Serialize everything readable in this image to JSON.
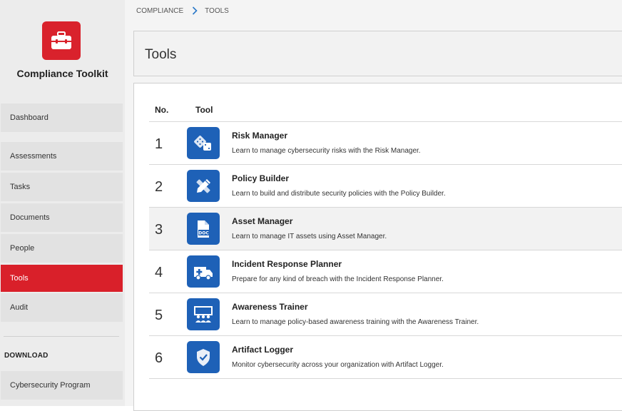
{
  "app": {
    "title": "Compliance Toolkit",
    "logo_icon": "toolbox-icon",
    "brand_color": "#d9222c"
  },
  "sidebar": {
    "items": [
      {
        "label": "Dashboard"
      },
      {
        "label": "Assessments"
      },
      {
        "label": "Tasks"
      },
      {
        "label": "Documents"
      },
      {
        "label": "People"
      },
      {
        "label": "Tools",
        "active": true
      },
      {
        "label": "Audit"
      }
    ],
    "download_section": {
      "label": "DOWNLOAD",
      "items": [
        {
          "label": "Cybersecurity Program"
        }
      ]
    }
  },
  "breadcrumb": {
    "items": [
      "COMPLIANCE",
      "TOOLS"
    ],
    "separator_icon": "chevron-right-icon"
  },
  "page": {
    "title": "Tools"
  },
  "table": {
    "headers": {
      "number": "No.",
      "tool": "Tool"
    },
    "rows": [
      {
        "number": "1",
        "icon": "dice-icon",
        "name": "Risk Manager",
        "description": "Learn to manage cybersecurity risks with the Risk Manager."
      },
      {
        "number": "2",
        "icon": "pencil-ruler-icon",
        "name": "Policy Builder",
        "description": "Learn to build and distribute security policies with the Policy Builder."
      },
      {
        "number": "3",
        "icon": "doc-file-icon",
        "name": "Asset Manager",
        "description": "Learn to manage IT assets using Asset Manager.",
        "highlighted": true
      },
      {
        "number": "4",
        "icon": "ambulance-icon",
        "name": "Incident Response Planner",
        "description": "Prepare for any kind of breach with the Incident Response Planner."
      },
      {
        "number": "5",
        "icon": "presentation-audience-icon",
        "name": "Awareness Trainer",
        "description": "Learn to manage policy-based awareness training with the Awareness Trainer."
      },
      {
        "number": "6",
        "icon": "shield-check-icon",
        "name": "Artifact Logger",
        "description": "Monitor cybersecurity across your organization with Artifact Logger."
      }
    ],
    "icon_color": "#1e61b7"
  }
}
